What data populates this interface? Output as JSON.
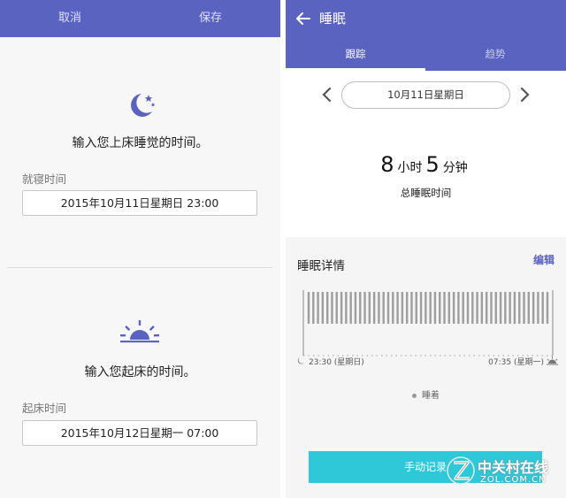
{
  "left": {
    "cancel_label": "取消",
    "save_label": "保存",
    "bedtime_question": "输入您上床睡觉的时间。",
    "bedtime_label": "就寝时间",
    "bedtime_value": "2015年10月11日星期日 23:00",
    "wake_question": "输入您起床的时间。",
    "wake_label": "起床时间",
    "wake_value": "2015年10月12日星期一 07:00",
    "icons": [
      "moon-stars-icon",
      "sunrise-icon"
    ]
  },
  "right": {
    "title": "睡眠",
    "tabs": [
      {
        "label": "跟踪",
        "active": true
      },
      {
        "label": "趋势",
        "active": false
      }
    ],
    "date": "10月11日星期日",
    "duration": {
      "hours": "8",
      "hours_unit": "小时",
      "minutes": "5",
      "minutes_unit": "分钟",
      "label": "总睡眠时间"
    },
    "details_title": "睡眠详情",
    "edit_label": "编辑",
    "chart": {
      "start_label": "23:30 (星期日)",
      "end_label": "07:35 (星期一)",
      "legend": "睡着",
      "bar_count": 52
    },
    "manual_button": "手动记录",
    "icons": [
      "back-arrow-icon",
      "chevron-left-icon",
      "chevron-right-icon"
    ]
  },
  "watermark": {
    "brand": "中关村在线",
    "site": "ZOL.COM.CN"
  },
  "colors": {
    "header": "#5b63c0",
    "accent_button": "#2ec8d8",
    "bar": "#9e9e9e"
  }
}
